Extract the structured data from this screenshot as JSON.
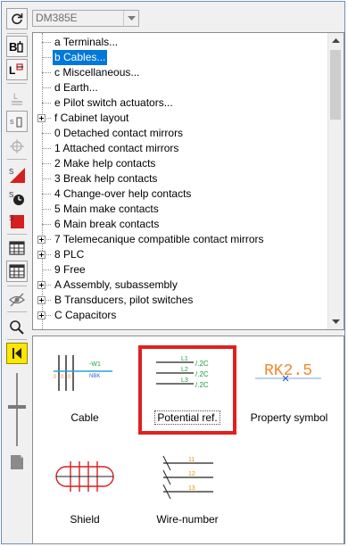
{
  "combo": {
    "value": "DM385E"
  },
  "tree": {
    "items": [
      {
        "code": "a",
        "label": "a Terminals...",
        "expandable": false,
        "selected": false
      },
      {
        "code": "b",
        "label": "b Cables...",
        "expandable": false,
        "selected": true
      },
      {
        "code": "c",
        "label": "c Miscellaneous...",
        "expandable": false,
        "selected": false
      },
      {
        "code": "d",
        "label": "d Earth...",
        "expandable": false,
        "selected": false
      },
      {
        "code": "e",
        "label": "e Pilot switch actuators...",
        "expandable": false,
        "selected": false
      },
      {
        "code": "f",
        "label": "f Cabinet layout",
        "expandable": true,
        "selected": false
      },
      {
        "code": "0",
        "label": "0 Detached contact mirrors",
        "expandable": false,
        "selected": false
      },
      {
        "code": "1",
        "label": "1 Attached contact mirrors",
        "expandable": false,
        "selected": false
      },
      {
        "code": "2",
        "label": "2 Make help contacts",
        "expandable": false,
        "selected": false
      },
      {
        "code": "3",
        "label": "3 Break help contacts",
        "expandable": false,
        "selected": false
      },
      {
        "code": "4",
        "label": "4 Change-over help contacts",
        "expandable": false,
        "selected": false
      },
      {
        "code": "5",
        "label": "5 Main make contacts",
        "expandable": false,
        "selected": false
      },
      {
        "code": "6",
        "label": "6 Main break contacts",
        "expandable": false,
        "selected": false
      },
      {
        "code": "7",
        "label": "7 Telemecanique compatible contact mirrors",
        "expandable": true,
        "selected": false
      },
      {
        "code": "8",
        "label": "8 PLC",
        "expandable": true,
        "selected": false
      },
      {
        "code": "9",
        "label": "9 Free",
        "expandable": false,
        "selected": false
      },
      {
        "code": "A",
        "label": "A Assembly, subassembly",
        "expandable": true,
        "selected": false
      },
      {
        "code": "B",
        "label": "B Transducers, pilot switches",
        "expandable": true,
        "selected": false
      },
      {
        "code": "C",
        "label": "C Capacitors",
        "expandable": true,
        "selected": false
      }
    ]
  },
  "gallery": {
    "items": [
      {
        "id": "cable",
        "label": "Cable"
      },
      {
        "id": "potential",
        "label": "Potential ref.",
        "highlighted": true,
        "marks": [
          "L1",
          "/.2C",
          "L2",
          "/.2C",
          "L3",
          "/.2C"
        ]
      },
      {
        "id": "property",
        "label": "Property symbol",
        "marks": [
          "RK2.5"
        ]
      },
      {
        "id": "shield",
        "label": "Shield"
      },
      {
        "id": "wire",
        "label": "Wire-number"
      }
    ]
  },
  "colors": {
    "selection": "#0078d7",
    "highlight": "#e02020",
    "symbol_green": "#1b9e3e",
    "symbol_orange": "#f08a30",
    "symbol_red": "#d42020"
  },
  "icons": {
    "toolbar": [
      "refresh-icon",
      "bold-symbol-icon",
      "insert-symbol-icon",
      "text-align-icon",
      "pin-icon",
      "move-icon",
      "red-symbol-icon",
      "clock-symbol-icon",
      "red-box-icon",
      "grid-view-icon",
      "list-view-icon",
      "hide-icon",
      "search-zoom-icon",
      "collapse-icon",
      "slider-icon",
      "page-icon"
    ]
  }
}
